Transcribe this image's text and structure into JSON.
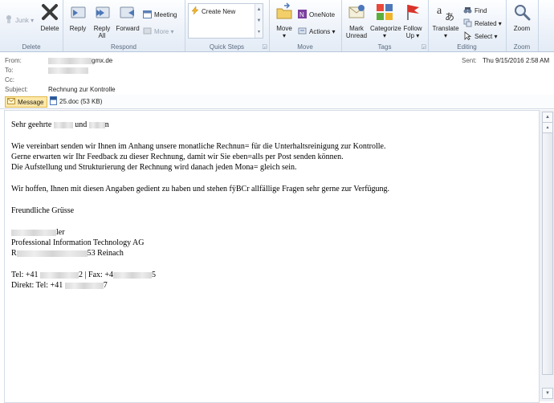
{
  "ribbon": {
    "groups": {
      "delete": "Delete",
      "respond": "Respond",
      "quick_steps": "Quick Steps",
      "move": "Move",
      "tags": "Tags",
      "editing": "Editing",
      "zoom": "Zoom"
    },
    "buttons": {
      "junk": "Junk",
      "delete": "Delete",
      "reply": "Reply",
      "reply_all_1": "Reply",
      "reply_all_2": "All",
      "forward": "Forward",
      "meeting": "Meeting",
      "more": "More",
      "create_new": "Create New",
      "move": "Move",
      "onenote": "OneNote",
      "actions": "Actions",
      "mark_unread_1": "Mark",
      "mark_unread_2": "Unread",
      "categorize": "Categorize",
      "follow_up_1": "Follow",
      "follow_up_2": "Up",
      "translate": "Translate",
      "find": "Find",
      "related": "Related",
      "select": "Select",
      "zoom": "Zoom"
    }
  },
  "header": {
    "from_label": "From:",
    "from_value": "gmx.de",
    "to_label": "To:",
    "cc_label": "Cc:",
    "subject_label": "Subject:",
    "subject_value": "Rechnung zur Kontrolle",
    "sent_label": "Sent:",
    "sent_value": "Thu 9/15/2016 2:58 AM"
  },
  "attachments": {
    "message_tab": "Message",
    "file": "25.doc (53 KB)"
  },
  "body": {
    "greeting_a": "Sehr geehrte ",
    "greeting_b": " und ",
    "greeting_c": "n",
    "p1_l1": "Wie vereinbart senden wir Ihnen im Anhang unsere monatliche Rechnun= für die Unterhaltsreinigung zur Kontrolle.",
    "p1_l2": "Gerne erwarten wir Ihr Feedback zu dieser Rechnung, damit wir Sie eben=alls per Post senden können.",
    "p1_l3": "Die Aufstellung und Strukturierung der Rechnung wird danach jeden Mona= gleich sein.",
    "p2": "Wir hoffen, Ihnen mit diesen Angaben gedient zu haben und stehen fÿBCr allfällige Fragen sehr gerne zur Verfügung.",
    "closing": "Freundliche Grüsse",
    "sig_name_b": "ler",
    "sig_company": "Professional Information Technology AG",
    "sig_addr_a": "R",
    "sig_addr_b": "53 Reinach",
    "tel_a": "Tel: +41 ",
    "tel_b": "2 | Fax: +4",
    "tel_c": "5",
    "direct_a": "Direkt: Tel: +41 ",
    "direct_b": "7"
  },
  "colors": {
    "accent": "#e3ebf5",
    "message_tab": "#fce8a8"
  }
}
